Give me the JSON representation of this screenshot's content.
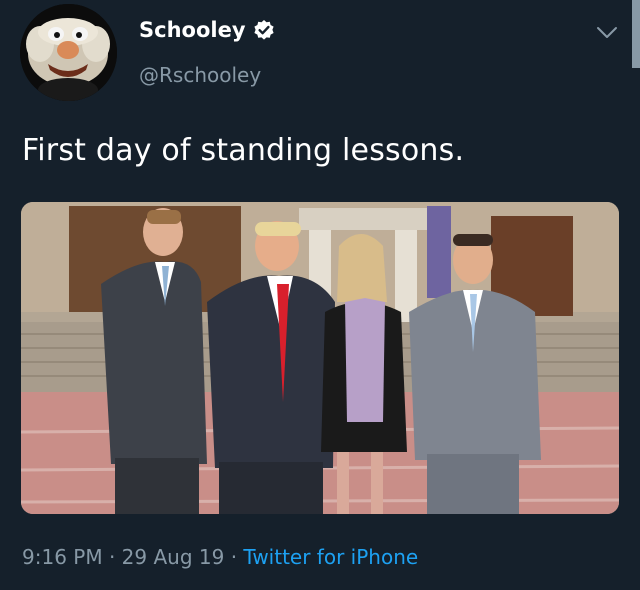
{
  "tweet": {
    "display_name": "Schooley",
    "handle": "@Rschooley",
    "verified_icon": "verified-badge-icon",
    "text": "First day of standing lessons.",
    "time": "9:16 PM",
    "date": "29 Aug 19",
    "separator": "·",
    "source": "Twitter for iPhone",
    "menu_icon": "chevron-down-icon"
  },
  "colors": {
    "background": "#15202b",
    "primary_text": "#ffffff",
    "secondary_text": "#8899a6",
    "link": "#1da1f2"
  }
}
